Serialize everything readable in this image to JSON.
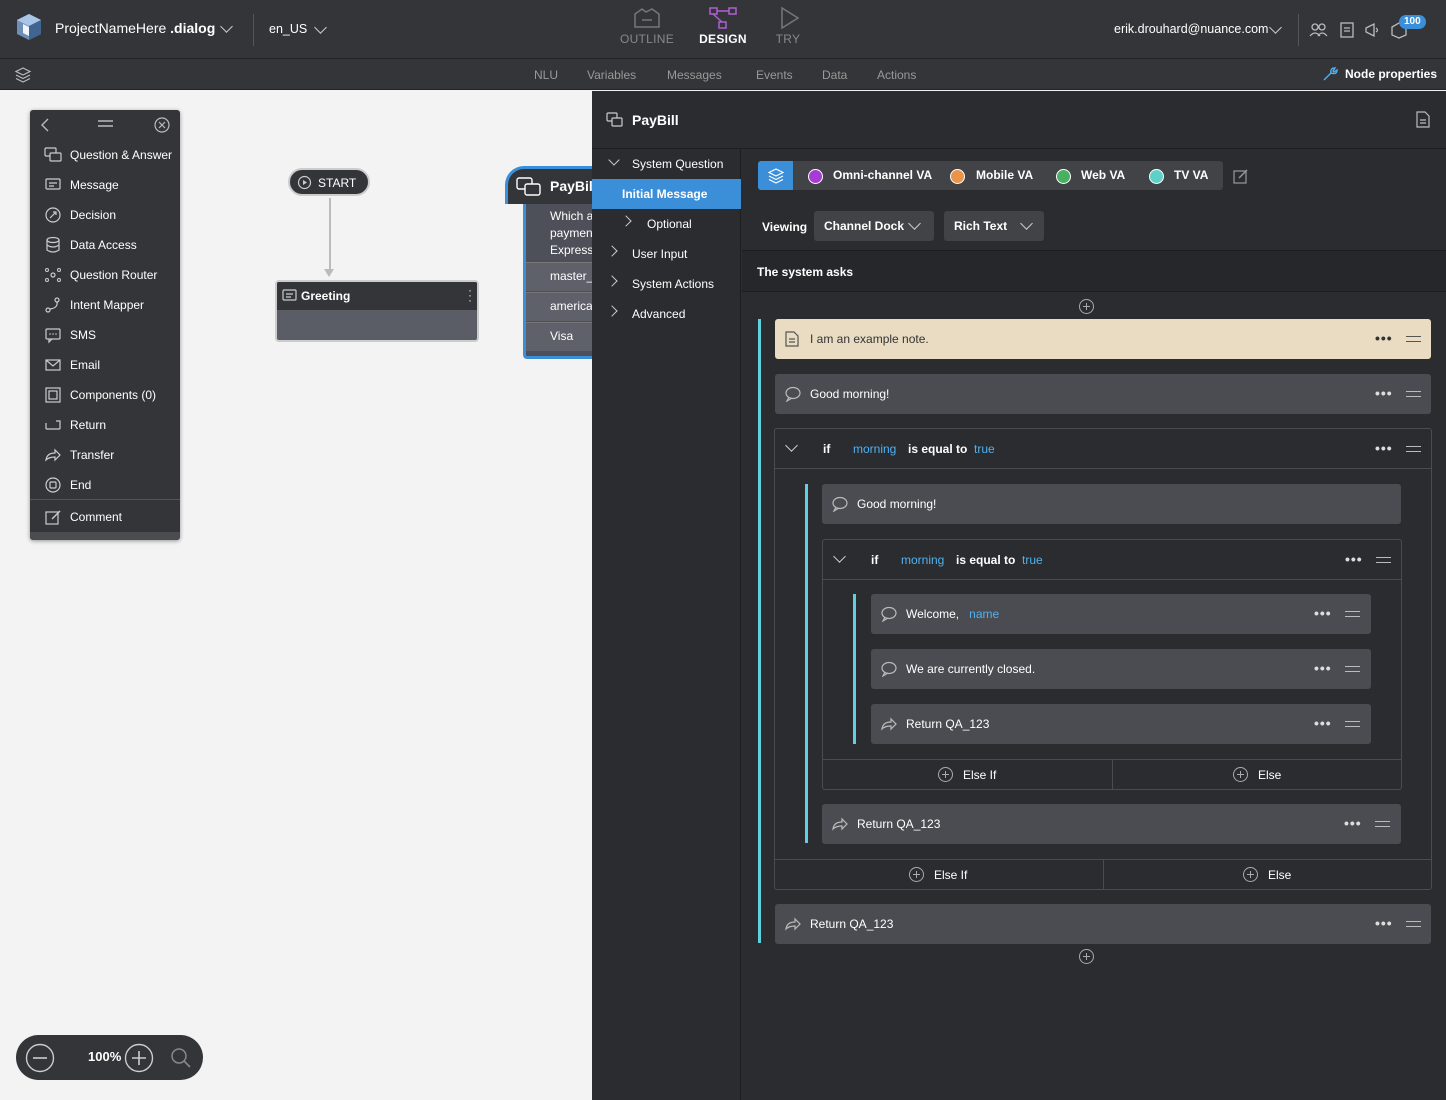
{
  "topbar": {
    "project_name": "ProjectNameHere",
    "project_ext": ".dialog",
    "locale": "en_US",
    "modes": [
      {
        "label": "OUTLINE"
      },
      {
        "label": "DESIGN"
      },
      {
        "label": "TRY"
      }
    ],
    "active_mode": "DESIGN",
    "user": "erik.drouhard@nuance.com",
    "notification_count": "100"
  },
  "secbar": {
    "items": [
      "NLU",
      "Variables",
      "Messages",
      "Events",
      "Data",
      "Actions"
    ],
    "node_properties": "Node properties"
  },
  "palette": {
    "items": [
      {
        "label": "Question & Answer",
        "icon": "qa-icon"
      },
      {
        "label": "Message",
        "icon": "message-icon"
      },
      {
        "label": "Decision",
        "icon": "decision-icon"
      },
      {
        "label": "Data Access",
        "icon": "database-icon"
      },
      {
        "label": "Question Router",
        "icon": "router-icon"
      },
      {
        "label": "Intent Mapper",
        "icon": "intent-icon"
      },
      {
        "label": "SMS",
        "icon": "sms-icon"
      },
      {
        "label": "Email",
        "icon": "email-icon"
      },
      {
        "label": "Components (0)",
        "icon": "components-icon"
      },
      {
        "label": "Return",
        "icon": "return-icon"
      },
      {
        "label": "Transfer",
        "icon": "transfer-icon"
      },
      {
        "label": "End",
        "icon": "end-icon"
      },
      {
        "label": "Comment",
        "icon": "comment-icon"
      }
    ]
  },
  "canvas": {
    "start_label": "START",
    "greeting_label": "Greeting",
    "paybill_label": "PayBill",
    "paybill_question": [
      "Which a",
      "paymen",
      "Express"
    ],
    "paybill_options": [
      "master_",
      "america",
      "Visa"
    ],
    "zoom": "100%"
  },
  "panel": {
    "title": "PayBill",
    "nav": {
      "system_question": "System Question",
      "initial_message": "Initial Message",
      "optional": "Optional",
      "user_input": "User Input",
      "system_actions": "System Actions",
      "advanced": "Advanced"
    },
    "channels": [
      {
        "label": "Omni-channel VA",
        "color": "#a83ad6"
      },
      {
        "label": "Mobile VA",
        "color": "#e8954a"
      },
      {
        "label": "Web VA",
        "color": "#49b062"
      },
      {
        "label": "TV VA",
        "color": "#5fd0c8"
      }
    ],
    "viewing_label": "Viewing",
    "view_mode": "Channel Dock",
    "format": "Rich Text",
    "system_asks": "The system asks",
    "note": "I am an example note.",
    "msg1": "Good morning!",
    "cond1": {
      "if": "if",
      "var": "morning",
      "op": "is equal to",
      "val": "true"
    },
    "msg2": "Good morning!",
    "cond2": {
      "if": "if",
      "var": "morning",
      "op": "is equal to",
      "val": "true"
    },
    "welcome": "Welcome,",
    "welcome_var": "name",
    "closed": "We are currently closed.",
    "return_inner": "Return QA_123",
    "else_if": "Else If",
    "else": "Else",
    "return_mid": "Return QA_123",
    "return_outer": "Return QA_123"
  }
}
